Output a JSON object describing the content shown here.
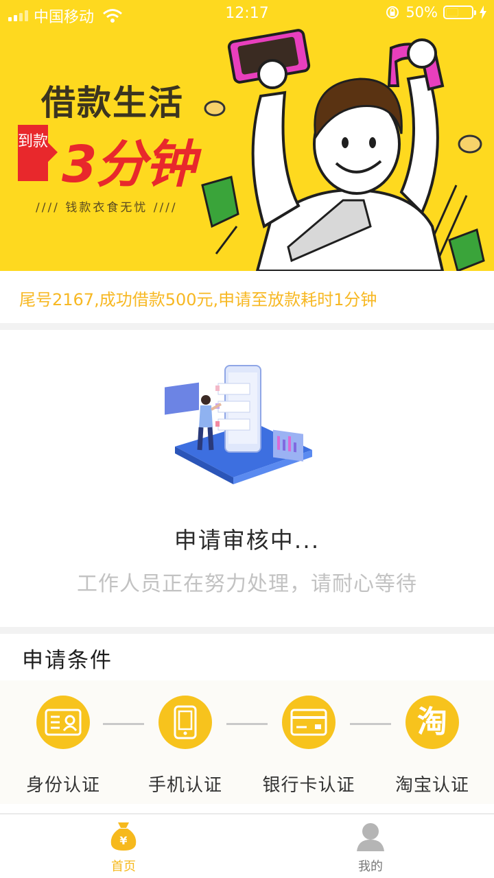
{
  "status_bar": {
    "carrier": "中国移动",
    "time": "12:17",
    "battery": "50%",
    "battery_level": 0.5
  },
  "banner": {
    "title": "借款生活",
    "tag": "到款",
    "highlight": "3分钟",
    "slogan": "//// 钱款衣食无忧 ////"
  },
  "ticker": {
    "text": "尾号2167,成功借款500元,申请至放款耗时1分钟"
  },
  "review": {
    "title": "申请审核中...",
    "subtitle": "工作人员正在努力处理，请耐心等待"
  },
  "conditions": {
    "title": "申请条件",
    "steps": [
      {
        "label": "身份认证",
        "icon": "id-card-icon"
      },
      {
        "label": "手机认证",
        "icon": "phone-icon"
      },
      {
        "label": "银行卡认证",
        "icon": "bank-card-icon"
      },
      {
        "label": "淘宝认证",
        "icon": "taobao-icon",
        "glyph": "淘"
      }
    ]
  },
  "tabbar": {
    "home": "首页",
    "me": "我的",
    "home_icon_glyph": "¥"
  },
  "colors": {
    "accent": "#f6b91d",
    "banner_bg": "#fed91f",
    "ticker_text": "#f7b823",
    "red": "#e8282c"
  }
}
